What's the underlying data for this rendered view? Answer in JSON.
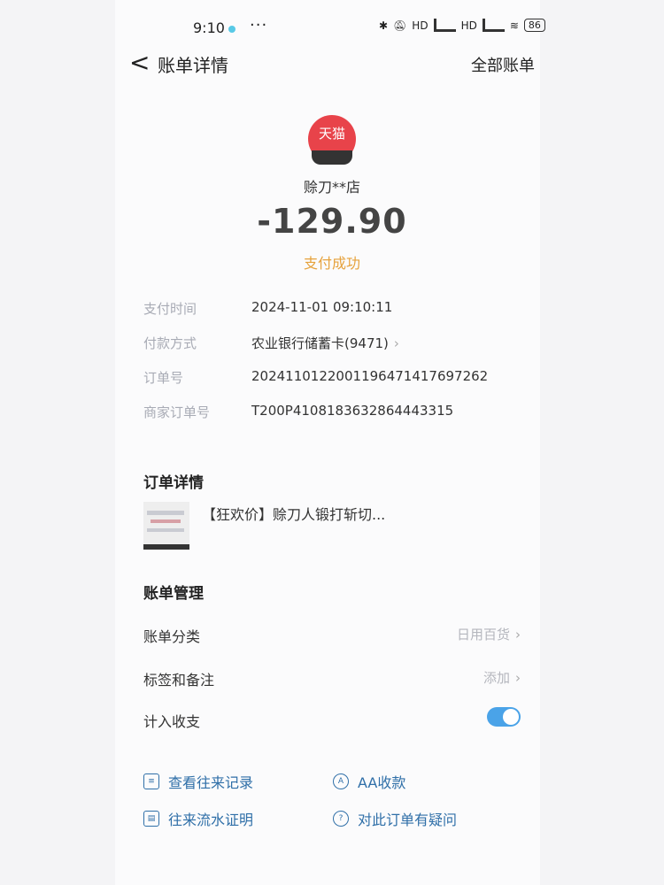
{
  "status_bar": {
    "time": "9:10",
    "more": "···",
    "hd1": "HD",
    "hd2": "HD",
    "battery": "86",
    "icons": [
      "dot-icon",
      "bluetooth-icon",
      "mute-icon",
      "signal-icon",
      "signal-icon",
      "wifi-icon",
      "battery-icon"
    ]
  },
  "nav": {
    "back": "<",
    "title": "账单详情",
    "all_bills": "全部账单"
  },
  "merchant": {
    "logo_text": "天猫",
    "name": "赊刀**店",
    "amount": "-129.90",
    "status": "支付成功",
    "status_color": "#e6a23c",
    "logo_color": "#e8434a"
  },
  "info": [
    {
      "label": "支付时间",
      "value": "2024-11-01 09:10:11"
    },
    {
      "label": "付款方式",
      "value": "农业银行储蓄卡(9471)"
    },
    {
      "label": "订单号",
      "value": "2024110122001196471417697262"
    },
    {
      "label": "商家订单号",
      "value": "T200P4108183632864443315"
    }
  ],
  "order_detail": {
    "title": "订单详情",
    "item": "【狂欢价】赊刀人锻打斩切..."
  },
  "bill_management": {
    "title": "账单管理",
    "category_label": "账单分类",
    "category_value": "日用百货",
    "tag_label": "标签和备注",
    "tag_value": "添加",
    "income_label": "计入收支",
    "income_on": true,
    "toggle_color": "#4aa3e8"
  },
  "actions": {
    "history": "查看往来记录",
    "aa": "AA收款",
    "proof": "往来流水证明",
    "question": "对此订单有疑问",
    "link_color": "#2f6fa8"
  }
}
